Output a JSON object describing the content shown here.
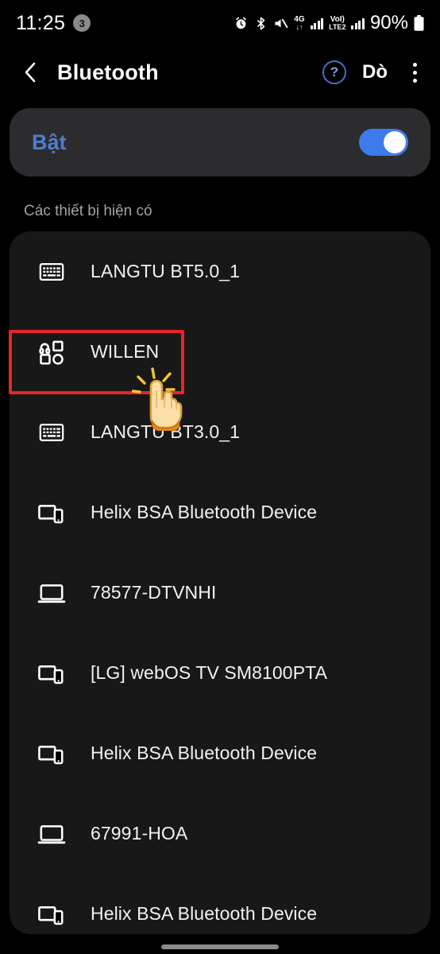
{
  "statusbar": {
    "time": "11:25",
    "notification_count": "3",
    "icons": [
      "alarm-icon",
      "bluetooth-icon",
      "mute-icon",
      "4g-data-icon",
      "signal-bars-icon",
      "volte-lte2-icon",
      "signal-bars-2-icon"
    ],
    "network_top": "4G",
    "network_sub_top": "VoI)",
    "network_sub_bottom": "LTE2",
    "battery": "90%"
  },
  "header": {
    "back_icon": "chevron-left-icon",
    "title": "Bluetooth",
    "help_icon": "?",
    "scan_label": "Dò",
    "menu_icon": "kebab-menu-icon"
  },
  "toggle_card": {
    "label": "Bật",
    "state": "on",
    "accent_color": "#3d7bed",
    "label_color": "#4d7ed0"
  },
  "section": {
    "available_devices_label": "Các thiết bị hiện có"
  },
  "devices": [
    {
      "name": "LANGTU BT5.0_1",
      "icon": "keyboard-icon"
    },
    {
      "name": "WILLEN",
      "icon": "generic-device-icon"
    },
    {
      "name": "LANGTU BT3.0_1",
      "icon": "keyboard-icon"
    },
    {
      "name": "Helix BSA Bluetooth Device",
      "icon": "tablet-phone-icon"
    },
    {
      "name": "78577-DTVNHI",
      "icon": "laptop-icon"
    },
    {
      "name": "[LG] webOS TV SM8100PTA",
      "icon": "tablet-phone-icon"
    },
    {
      "name": "Helix BSA Bluetooth Device",
      "icon": "tablet-phone-icon"
    },
    {
      "name": "67991-HOA",
      "icon": "laptop-icon"
    },
    {
      "name": "Helix BSA Bluetooth Device",
      "icon": "tablet-phone-icon"
    }
  ],
  "annotation": {
    "highlight_color": "#e8252a",
    "highlight_target": "WILLEN",
    "cursor": "pointing-hand-cursor"
  }
}
